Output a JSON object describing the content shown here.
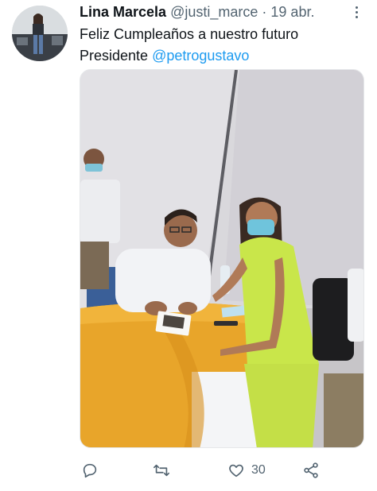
{
  "tweet": {
    "display_name": "Lina Marcela",
    "handle": "@justi_marce",
    "separator": "·",
    "date": "19 abr.",
    "text_line1": "Feliz Cumpleaños a nuestro futuro",
    "text_line2_prefix": "Presidente ",
    "mention": "@petrogustavo",
    "likes": "30"
  },
  "icons": {
    "reply": "reply-icon",
    "retweet": "retweet-icon",
    "like": "heart-icon",
    "share": "share-icon",
    "more": "more-options-icon"
  },
  "colors": {
    "link": "#1d9bf0",
    "secondary_text": "#536471",
    "table_cloth": "#e8a52a",
    "scrubs": "#c9e64a"
  }
}
